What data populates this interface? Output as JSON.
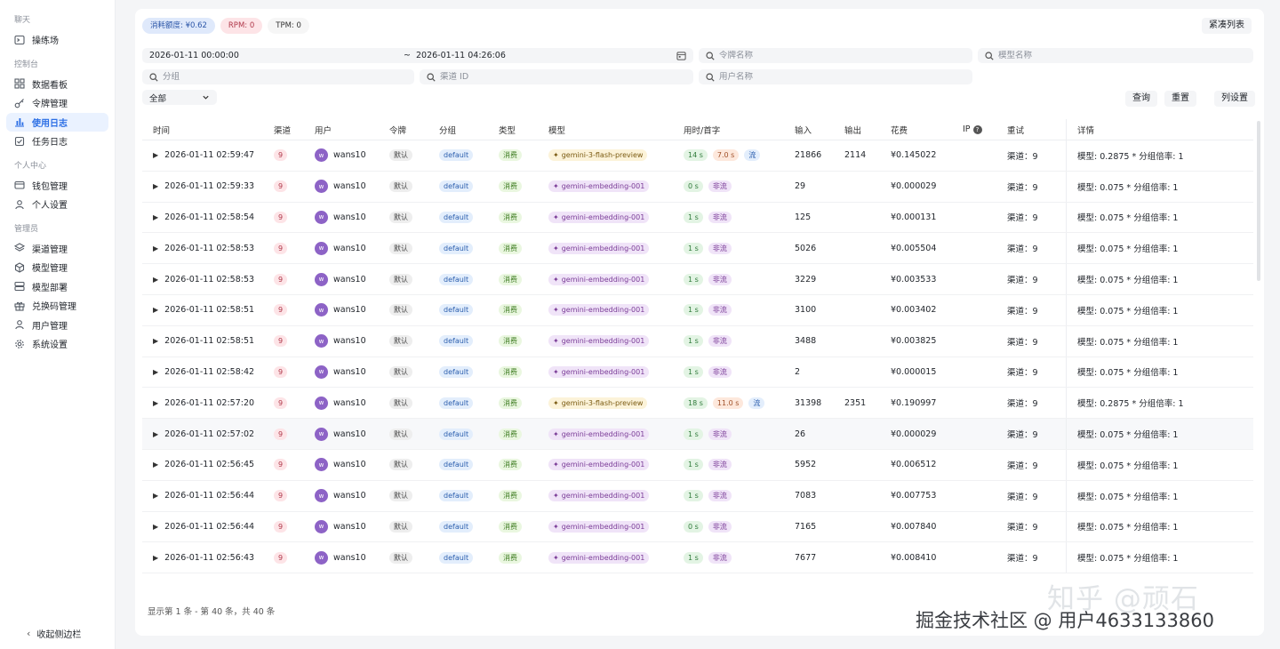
{
  "sidebar": {
    "sections": [
      {
        "label": "聊天",
        "items": [
          {
            "label": "操练场",
            "icon": "terminal-icon"
          }
        ]
      },
      {
        "label": "控制台",
        "items": [
          {
            "label": "数据看板",
            "icon": "grid-icon"
          },
          {
            "label": "令牌管理",
            "icon": "key-icon"
          },
          {
            "label": "使用日志",
            "icon": "bar-chart-icon",
            "active": true
          },
          {
            "label": "任务日志",
            "icon": "checklist-icon"
          }
        ]
      },
      {
        "label": "个人中心",
        "items": [
          {
            "label": "钱包管理",
            "icon": "wallet-icon"
          },
          {
            "label": "个人设置",
            "icon": "user-icon"
          }
        ]
      },
      {
        "label": "管理员",
        "items": [
          {
            "label": "渠道管理",
            "icon": "layers-icon"
          },
          {
            "label": "模型管理",
            "icon": "cube-icon"
          },
          {
            "label": "模型部署",
            "icon": "server-icon"
          },
          {
            "label": "兑换码管理",
            "icon": "gift-icon"
          },
          {
            "label": "用户管理",
            "icon": "user-icon"
          },
          {
            "label": "系统设置",
            "icon": "gear-icon"
          }
        ]
      }
    ],
    "collapse_label": "收起侧边栏"
  },
  "stats": {
    "quota": "消耗额度: ¥0.62",
    "rpm": "RPM: 0",
    "tpm": "TPM: 0"
  },
  "compact_label": "紧凑列表",
  "filters": {
    "start_time": "2026-01-11 00:00:00",
    "range_sep": "~",
    "end_time": "2026-01-11 04:26:06",
    "token_ph": "令牌名称",
    "model_ph": "模型名称",
    "group_ph": "分组",
    "channel_ph": "渠道 ID",
    "user_ph": "用户名称",
    "type_value": "全部"
  },
  "actions": {
    "query": "查询",
    "reset": "重置",
    "columns": "列设置"
  },
  "columns": [
    "时间",
    "渠道",
    "用户",
    "令牌",
    "分组",
    "类型",
    "模型",
    "用时/首字",
    "输入",
    "输出",
    "花费",
    "IP",
    "重试",
    "详情"
  ],
  "rows": [
    {
      "time": "2026-01-11 02:59:47",
      "channel": "9",
      "user": "wans10",
      "avatar": "w",
      "token": "默认",
      "group": "default",
      "type": "消费",
      "model": "gemini-3-flash-preview",
      "dur": "14 s",
      "first": "7.0 s",
      "mode": "流",
      "input": "21866",
      "output": "2114",
      "cost": "¥0.145022",
      "retry": "渠道：9",
      "detail": "模型: 0.2875 * 分组倍率: 1"
    },
    {
      "time": "2026-01-11 02:59:33",
      "channel": "9",
      "user": "wans10",
      "avatar": "w",
      "token": "默认",
      "group": "default",
      "type": "消费",
      "model": "gemini-embedding-001",
      "dur": "0 s",
      "first": "",
      "mode": "非流",
      "input": "29",
      "output": "",
      "cost": "¥0.000029",
      "retry": "渠道：9",
      "detail": "模型: 0.075 * 分组倍率: 1"
    },
    {
      "time": "2026-01-11 02:58:54",
      "channel": "9",
      "user": "wans10",
      "avatar": "w",
      "token": "默认",
      "group": "default",
      "type": "消费",
      "model": "gemini-embedding-001",
      "dur": "1 s",
      "first": "",
      "mode": "非流",
      "input": "125",
      "output": "",
      "cost": "¥0.000131",
      "retry": "渠道：9",
      "detail": "模型: 0.075 * 分组倍率: 1"
    },
    {
      "time": "2026-01-11 02:58:53",
      "channel": "9",
      "user": "wans10",
      "avatar": "w",
      "token": "默认",
      "group": "default",
      "type": "消费",
      "model": "gemini-embedding-001",
      "dur": "1 s",
      "first": "",
      "mode": "非流",
      "input": "5026",
      "output": "",
      "cost": "¥0.005504",
      "retry": "渠道：9",
      "detail": "模型: 0.075 * 分组倍率: 1"
    },
    {
      "time": "2026-01-11 02:58:53",
      "channel": "9",
      "user": "wans10",
      "avatar": "w",
      "token": "默认",
      "group": "default",
      "type": "消费",
      "model": "gemini-embedding-001",
      "dur": "1 s",
      "first": "",
      "mode": "非流",
      "input": "3229",
      "output": "",
      "cost": "¥0.003533",
      "retry": "渠道：9",
      "detail": "模型: 0.075 * 分组倍率: 1"
    },
    {
      "time": "2026-01-11 02:58:51",
      "channel": "9",
      "user": "wans10",
      "avatar": "w",
      "token": "默认",
      "group": "default",
      "type": "消费",
      "model": "gemini-embedding-001",
      "dur": "1 s",
      "first": "",
      "mode": "非流",
      "input": "3100",
      "output": "",
      "cost": "¥0.003402",
      "retry": "渠道：9",
      "detail": "模型: 0.075 * 分组倍率: 1"
    },
    {
      "time": "2026-01-11 02:58:51",
      "channel": "9",
      "user": "wans10",
      "avatar": "w",
      "token": "默认",
      "group": "default",
      "type": "消费",
      "model": "gemini-embedding-001",
      "dur": "1 s",
      "first": "",
      "mode": "非流",
      "input": "3488",
      "output": "",
      "cost": "¥0.003825",
      "retry": "渠道：9",
      "detail": "模型: 0.075 * 分组倍率: 1"
    },
    {
      "time": "2026-01-11 02:58:42",
      "channel": "9",
      "user": "wans10",
      "avatar": "w",
      "token": "默认",
      "group": "default",
      "type": "消费",
      "model": "gemini-embedding-001",
      "dur": "1 s",
      "first": "",
      "mode": "非流",
      "input": "2",
      "output": "",
      "cost": "¥0.000015",
      "retry": "渠道：9",
      "detail": "模型: 0.075 * 分组倍率: 1"
    },
    {
      "time": "2026-01-11 02:57:20",
      "channel": "9",
      "user": "wans10",
      "avatar": "w",
      "token": "默认",
      "group": "default",
      "type": "消费",
      "model": "gemini-3-flash-preview",
      "dur": "18 s",
      "first": "11.0 s",
      "mode": "流",
      "input": "31398",
      "output": "2351",
      "cost": "¥0.190997",
      "retry": "渠道：9",
      "detail": "模型: 0.2875 * 分组倍率: 1"
    },
    {
      "time": "2026-01-11 02:57:02",
      "channel": "9",
      "user": "wans10",
      "avatar": "w",
      "token": "默认",
      "group": "default",
      "type": "消费",
      "model": "gemini-embedding-001",
      "dur": "1 s",
      "first": "",
      "mode": "非流",
      "input": "26",
      "output": "",
      "cost": "¥0.000029",
      "retry": "渠道：9",
      "detail": "模型: 0.075 * 分组倍率: 1",
      "highlight": true
    },
    {
      "time": "2026-01-11 02:56:45",
      "channel": "9",
      "user": "wans10",
      "avatar": "w",
      "token": "默认",
      "group": "default",
      "type": "消费",
      "model": "gemini-embedding-001",
      "dur": "1 s",
      "first": "",
      "mode": "非流",
      "input": "5952",
      "output": "",
      "cost": "¥0.006512",
      "retry": "渠道：9",
      "detail": "模型: 0.075 * 分组倍率: 1"
    },
    {
      "time": "2026-01-11 02:56:44",
      "channel": "9",
      "user": "wans10",
      "avatar": "w",
      "token": "默认",
      "group": "default",
      "type": "消费",
      "model": "gemini-embedding-001",
      "dur": "1 s",
      "first": "",
      "mode": "非流",
      "input": "7083",
      "output": "",
      "cost": "¥0.007753",
      "retry": "渠道：9",
      "detail": "模型: 0.075 * 分组倍率: 1"
    },
    {
      "time": "2026-01-11 02:56:44",
      "channel": "9",
      "user": "wans10",
      "avatar": "w",
      "token": "默认",
      "group": "default",
      "type": "消费",
      "model": "gemini-embedding-001",
      "dur": "0 s",
      "first": "",
      "mode": "非流",
      "input": "7165",
      "output": "",
      "cost": "¥0.007840",
      "retry": "渠道：9",
      "detail": "模型: 0.075 * 分组倍率: 1"
    },
    {
      "time": "2026-01-11 02:56:43",
      "channel": "9",
      "user": "wans10",
      "avatar": "w",
      "token": "默认",
      "group": "default",
      "type": "消费",
      "model": "gemini-embedding-001",
      "dur": "1 s",
      "first": "",
      "mode": "非流",
      "input": "7677",
      "output": "",
      "cost": "¥0.008410",
      "retry": "渠道：9",
      "detail": "模型: 0.075 * 分组倍率: 1"
    }
  ],
  "pagination_text": "显示第 1 条 - 第 40 条，共 40 条",
  "watermark": {
    "line1": "知乎 @顽石",
    "line2": "掘金技术社区 @ 用户4633133860"
  }
}
